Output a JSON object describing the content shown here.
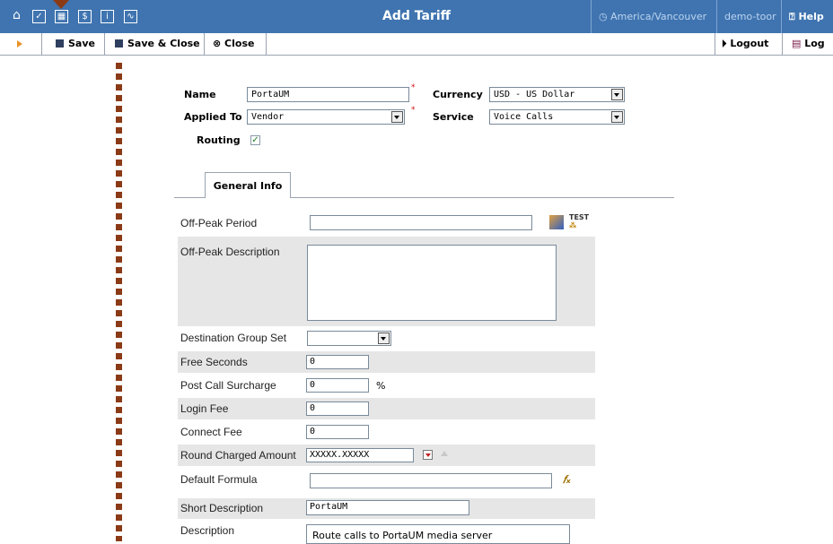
{
  "window": {
    "title": "Add Tariff",
    "timezone": "America/Vancouver",
    "user": "demo-toor",
    "help": "Help"
  },
  "toolbar": {
    "save": "Save",
    "save_close": "Save & Close",
    "close": "Close",
    "logout": "Logout",
    "log": "Log"
  },
  "form": {
    "name_label": "Name",
    "name_value": "PortaUM",
    "applied_to_label": "Applied To",
    "applied_to_value": "Vendor",
    "routing_label": "Routing",
    "routing_checked": true,
    "currency_label": "Currency",
    "currency_value": "USD - US Dollar",
    "service_label": "Service",
    "service_value": "Voice Calls"
  },
  "tabs": {
    "general_info": "General Info"
  },
  "general": {
    "off_peak_period": "Off-Peak Period",
    "off_peak_description": "Off-Peak Description",
    "destination_group_set": "Destination Group Set",
    "free_seconds": "Free Seconds",
    "free_seconds_value": "0",
    "post_call_surcharge": "Post Call Surcharge",
    "post_call_surcharge_value": "0",
    "percent": "%",
    "login_fee": "Login Fee",
    "login_fee_value": "0",
    "connect_fee": "Connect Fee",
    "connect_fee_value": "0",
    "round_charged_amount": "Round Charged Amount",
    "round_charged_amount_value": "XXXXX.XXXXX",
    "default_formula": "Default Formula",
    "short_description": "Short Description",
    "short_description_value": "PortaUM",
    "description": "Description",
    "description_value": "Route calls to PortaUM media server",
    "test_label": "TEST"
  },
  "colors": {
    "topbar": "#3f74b0",
    "annotation": "#8b3a16",
    "row_shade": "#e6e6e6",
    "required": "#d01010"
  }
}
